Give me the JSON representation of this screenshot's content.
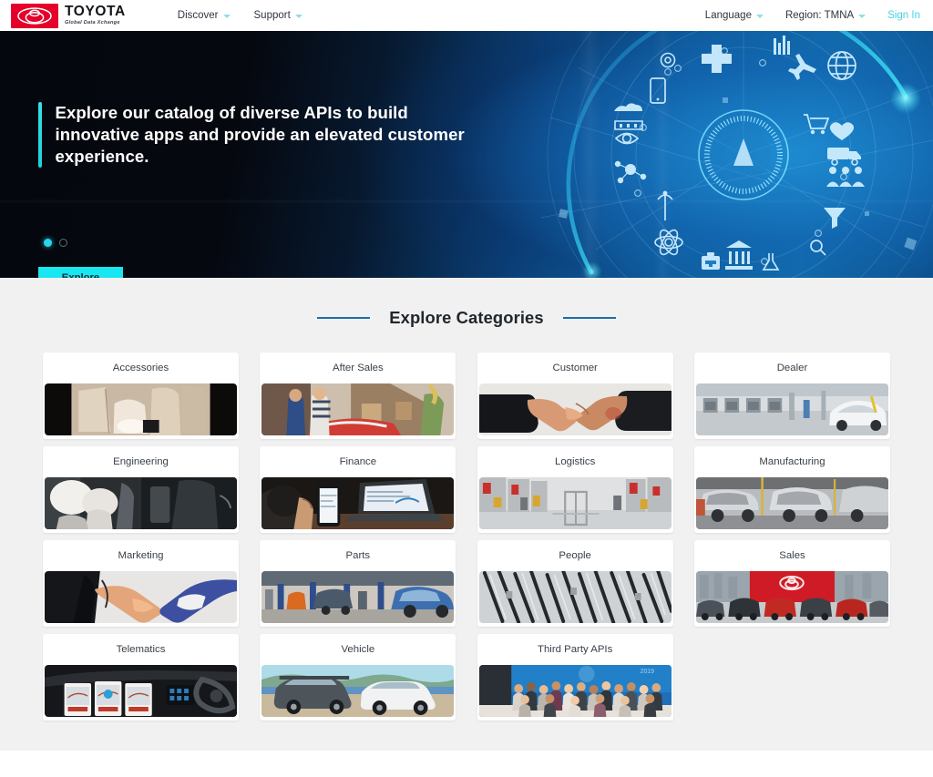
{
  "nav": {
    "brand": {
      "name": "TOYOTA",
      "tagline": "Global Data Xchange",
      "logo_icon": "toyota-emblem-icon"
    },
    "left_items": [
      {
        "label": "Discover",
        "icon": "chevron-down-icon"
      },
      {
        "label": "Support",
        "icon": "chevron-down-icon"
      }
    ],
    "right_items": [
      {
        "label": "Language",
        "icon": "chevron-down-icon"
      },
      {
        "label": "Region: TMNA",
        "icon": "chevron-down-icon"
      }
    ],
    "sign_in": "Sign In",
    "sign_in_color": "#49d3e0"
  },
  "hero": {
    "headline": "Explore our catalog of diverse APIs to build innovative apps and provide an elevated customer experience.",
    "cta_label": "Explore",
    "cta_color": "#18e6f0",
    "accent_color": "#2ad4ec",
    "carousel": {
      "total": 2,
      "active_index": 0
    },
    "graphic_alt": "digital-technology-icons-circle-graphic"
  },
  "categories": {
    "heading": "Explore Categories",
    "rule_color": "#1a6ea8",
    "items": [
      {
        "label": "Accessories",
        "image": "car-interior-seats"
      },
      {
        "label": "After Sales",
        "image": "family-at-dealership"
      },
      {
        "label": "Customer",
        "image": "handshake"
      },
      {
        "label": "Dealer",
        "image": "dealership-service-bay"
      },
      {
        "label": "Engineering",
        "image": "airbag-deployment-test"
      },
      {
        "label": "Finance",
        "image": "phone-laptop-desk"
      },
      {
        "label": "Logistics",
        "image": "warehouse-aisle"
      },
      {
        "label": "Manufacturing",
        "image": "assembly-line-car-bodies"
      },
      {
        "label": "Marketing",
        "image": "business-handshake-suit"
      },
      {
        "label": "Parts",
        "image": "parts-service-shop"
      },
      {
        "label": "People",
        "image": "wiper-blades-stack"
      },
      {
        "label": "Sales",
        "image": "showroom-cars-red-wall"
      },
      {
        "label": "Telematics",
        "image": "car-dashboard-navigation"
      },
      {
        "label": "Vehicle",
        "image": "two-suvs-landscape"
      },
      {
        "label": "Third Party APIs",
        "image": "group-team-photo"
      }
    ]
  }
}
